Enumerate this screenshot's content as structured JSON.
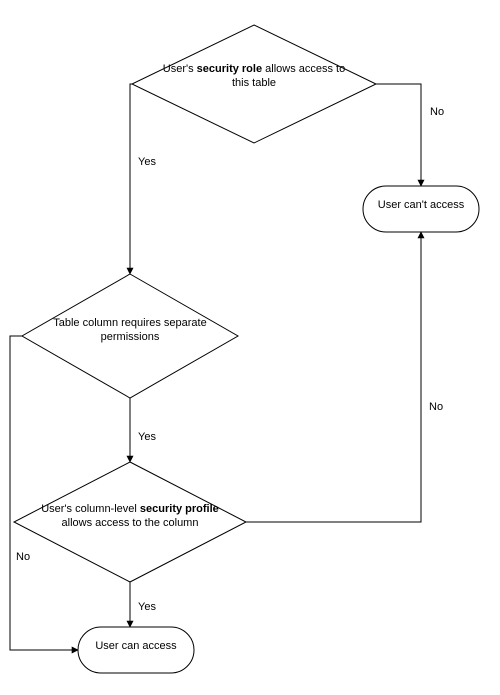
{
  "diagram": {
    "decision1": {
      "prefix": "User's ",
      "bold": "security role",
      "suffix": " allows access to",
      "line2": "this table"
    },
    "decision2": {
      "line1": "Table column requires separate",
      "line2": "permissions"
    },
    "decision3": {
      "prefix": "User's column-level ",
      "bold": "security profile",
      "line2": "allows access to the column"
    },
    "terminal_cant": "User can't access",
    "terminal_can": "User can access",
    "labels": {
      "yes": "Yes",
      "no": "No"
    }
  }
}
